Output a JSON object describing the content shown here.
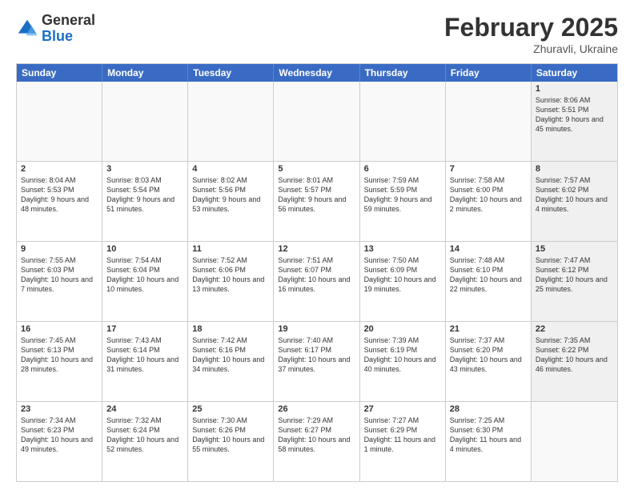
{
  "header": {
    "logo_general": "General",
    "logo_blue": "Blue",
    "month_title": "February 2025",
    "location": "Zhuravli, Ukraine"
  },
  "weekdays": [
    "Sunday",
    "Monday",
    "Tuesday",
    "Wednesday",
    "Thursday",
    "Friday",
    "Saturday"
  ],
  "weeks": [
    [
      {
        "day": "",
        "info": "",
        "empty": true
      },
      {
        "day": "",
        "info": "",
        "empty": true
      },
      {
        "day": "",
        "info": "",
        "empty": true
      },
      {
        "day": "",
        "info": "",
        "empty": true
      },
      {
        "day": "",
        "info": "",
        "empty": true
      },
      {
        "day": "",
        "info": "",
        "empty": true
      },
      {
        "day": "1",
        "info": "Sunrise: 8:06 AM\nSunset: 5:51 PM\nDaylight: 9 hours and 45 minutes.",
        "shaded": true
      }
    ],
    [
      {
        "day": "2",
        "info": "Sunrise: 8:04 AM\nSunset: 5:53 PM\nDaylight: 9 hours and 48 minutes."
      },
      {
        "day": "3",
        "info": "Sunrise: 8:03 AM\nSunset: 5:54 PM\nDaylight: 9 hours and 51 minutes."
      },
      {
        "day": "4",
        "info": "Sunrise: 8:02 AM\nSunset: 5:56 PM\nDaylight: 9 hours and 53 minutes."
      },
      {
        "day": "5",
        "info": "Sunrise: 8:01 AM\nSunset: 5:57 PM\nDaylight: 9 hours and 56 minutes."
      },
      {
        "day": "6",
        "info": "Sunrise: 7:59 AM\nSunset: 5:59 PM\nDaylight: 9 hours and 59 minutes."
      },
      {
        "day": "7",
        "info": "Sunrise: 7:58 AM\nSunset: 6:00 PM\nDaylight: 10 hours and 2 minutes."
      },
      {
        "day": "8",
        "info": "Sunrise: 7:57 AM\nSunset: 6:02 PM\nDaylight: 10 hours and 4 minutes.",
        "shaded": true
      }
    ],
    [
      {
        "day": "9",
        "info": "Sunrise: 7:55 AM\nSunset: 6:03 PM\nDaylight: 10 hours and 7 minutes."
      },
      {
        "day": "10",
        "info": "Sunrise: 7:54 AM\nSunset: 6:04 PM\nDaylight: 10 hours and 10 minutes."
      },
      {
        "day": "11",
        "info": "Sunrise: 7:52 AM\nSunset: 6:06 PM\nDaylight: 10 hours and 13 minutes."
      },
      {
        "day": "12",
        "info": "Sunrise: 7:51 AM\nSunset: 6:07 PM\nDaylight: 10 hours and 16 minutes."
      },
      {
        "day": "13",
        "info": "Sunrise: 7:50 AM\nSunset: 6:09 PM\nDaylight: 10 hours and 19 minutes."
      },
      {
        "day": "14",
        "info": "Sunrise: 7:48 AM\nSunset: 6:10 PM\nDaylight: 10 hours and 22 minutes."
      },
      {
        "day": "15",
        "info": "Sunrise: 7:47 AM\nSunset: 6:12 PM\nDaylight: 10 hours and 25 minutes.",
        "shaded": true
      }
    ],
    [
      {
        "day": "16",
        "info": "Sunrise: 7:45 AM\nSunset: 6:13 PM\nDaylight: 10 hours and 28 minutes."
      },
      {
        "day": "17",
        "info": "Sunrise: 7:43 AM\nSunset: 6:14 PM\nDaylight: 10 hours and 31 minutes."
      },
      {
        "day": "18",
        "info": "Sunrise: 7:42 AM\nSunset: 6:16 PM\nDaylight: 10 hours and 34 minutes."
      },
      {
        "day": "19",
        "info": "Sunrise: 7:40 AM\nSunset: 6:17 PM\nDaylight: 10 hours and 37 minutes."
      },
      {
        "day": "20",
        "info": "Sunrise: 7:39 AM\nSunset: 6:19 PM\nDaylight: 10 hours and 40 minutes."
      },
      {
        "day": "21",
        "info": "Sunrise: 7:37 AM\nSunset: 6:20 PM\nDaylight: 10 hours and 43 minutes."
      },
      {
        "day": "22",
        "info": "Sunrise: 7:35 AM\nSunset: 6:22 PM\nDaylight: 10 hours and 46 minutes.",
        "shaded": true
      }
    ],
    [
      {
        "day": "23",
        "info": "Sunrise: 7:34 AM\nSunset: 6:23 PM\nDaylight: 10 hours and 49 minutes."
      },
      {
        "day": "24",
        "info": "Sunrise: 7:32 AM\nSunset: 6:24 PM\nDaylight: 10 hours and 52 minutes."
      },
      {
        "day": "25",
        "info": "Sunrise: 7:30 AM\nSunset: 6:26 PM\nDaylight: 10 hours and 55 minutes."
      },
      {
        "day": "26",
        "info": "Sunrise: 7:29 AM\nSunset: 6:27 PM\nDaylight: 10 hours and 58 minutes."
      },
      {
        "day": "27",
        "info": "Sunrise: 7:27 AM\nSunset: 6:29 PM\nDaylight: 11 hours and 1 minute."
      },
      {
        "day": "28",
        "info": "Sunrise: 7:25 AM\nSunset: 6:30 PM\nDaylight: 11 hours and 4 minutes."
      },
      {
        "day": "",
        "info": "",
        "empty": true
      }
    ]
  ]
}
